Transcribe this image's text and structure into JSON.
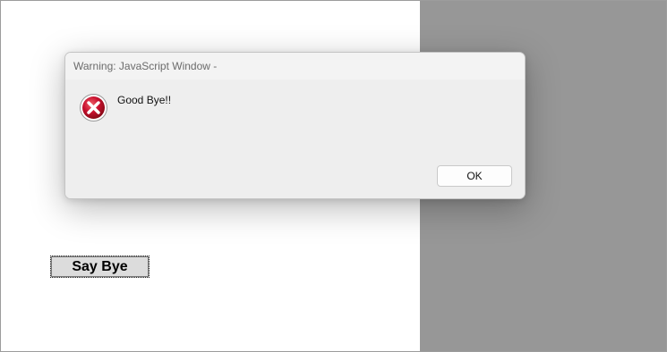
{
  "page": {
    "button_label": "Say Bye"
  },
  "dialog": {
    "title": "Warning: JavaScript Window -",
    "message": "Good Bye!!",
    "icon": "error-icon",
    "ok_label": "OK"
  },
  "colors": {
    "right_pane": "#979797",
    "dialog_bg": "#efefef",
    "error_red": "#c8102e"
  }
}
